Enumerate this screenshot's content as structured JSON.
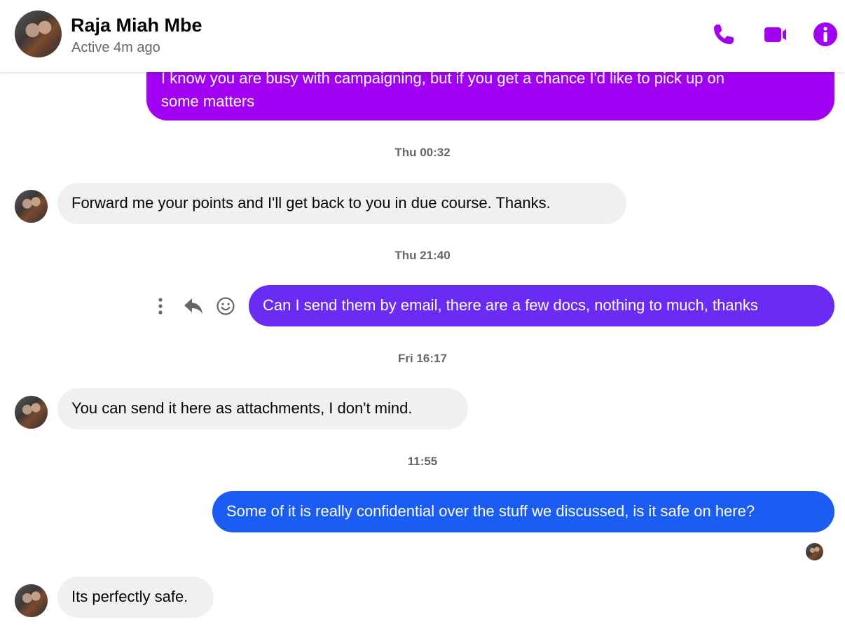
{
  "header": {
    "contact_name": "Raja Miah Mbe",
    "status": "Active 4m ago",
    "icons": [
      "phone-icon",
      "video-camera-icon",
      "info-icon"
    ],
    "accent_color": "#a100f2"
  },
  "messages": [
    {
      "type": "outgoing",
      "text_line1": "I know you are busy with campaigning, but if you get a chance I'd like to pick up on",
      "text_line2": "some matters",
      "color": "#a100f2"
    },
    {
      "type": "timestamp",
      "text": "Thu 00:32"
    },
    {
      "type": "incoming",
      "text": "Forward me your points and I'll get back to you in due course. Thanks."
    },
    {
      "type": "timestamp",
      "text": "Thu 21:40"
    },
    {
      "type": "outgoing",
      "text": "Can I send them by email, there are a few docs, nothing to much, thanks",
      "color": "#6a2cf5",
      "actions": [
        "more-options-icon",
        "reply-icon",
        "react-emoji-icon"
      ]
    },
    {
      "type": "timestamp",
      "text": "Fri 16:17"
    },
    {
      "type": "incoming",
      "text": "You can send it here as attachments, I don't mind."
    },
    {
      "type": "timestamp",
      "text": "11:55"
    },
    {
      "type": "outgoing",
      "text": "Some of it is really confidential over the stuff we discussed, is it safe on here?",
      "color": "#1b5cf2"
    },
    {
      "type": "incoming",
      "text": "Its perfectly safe."
    }
  ]
}
